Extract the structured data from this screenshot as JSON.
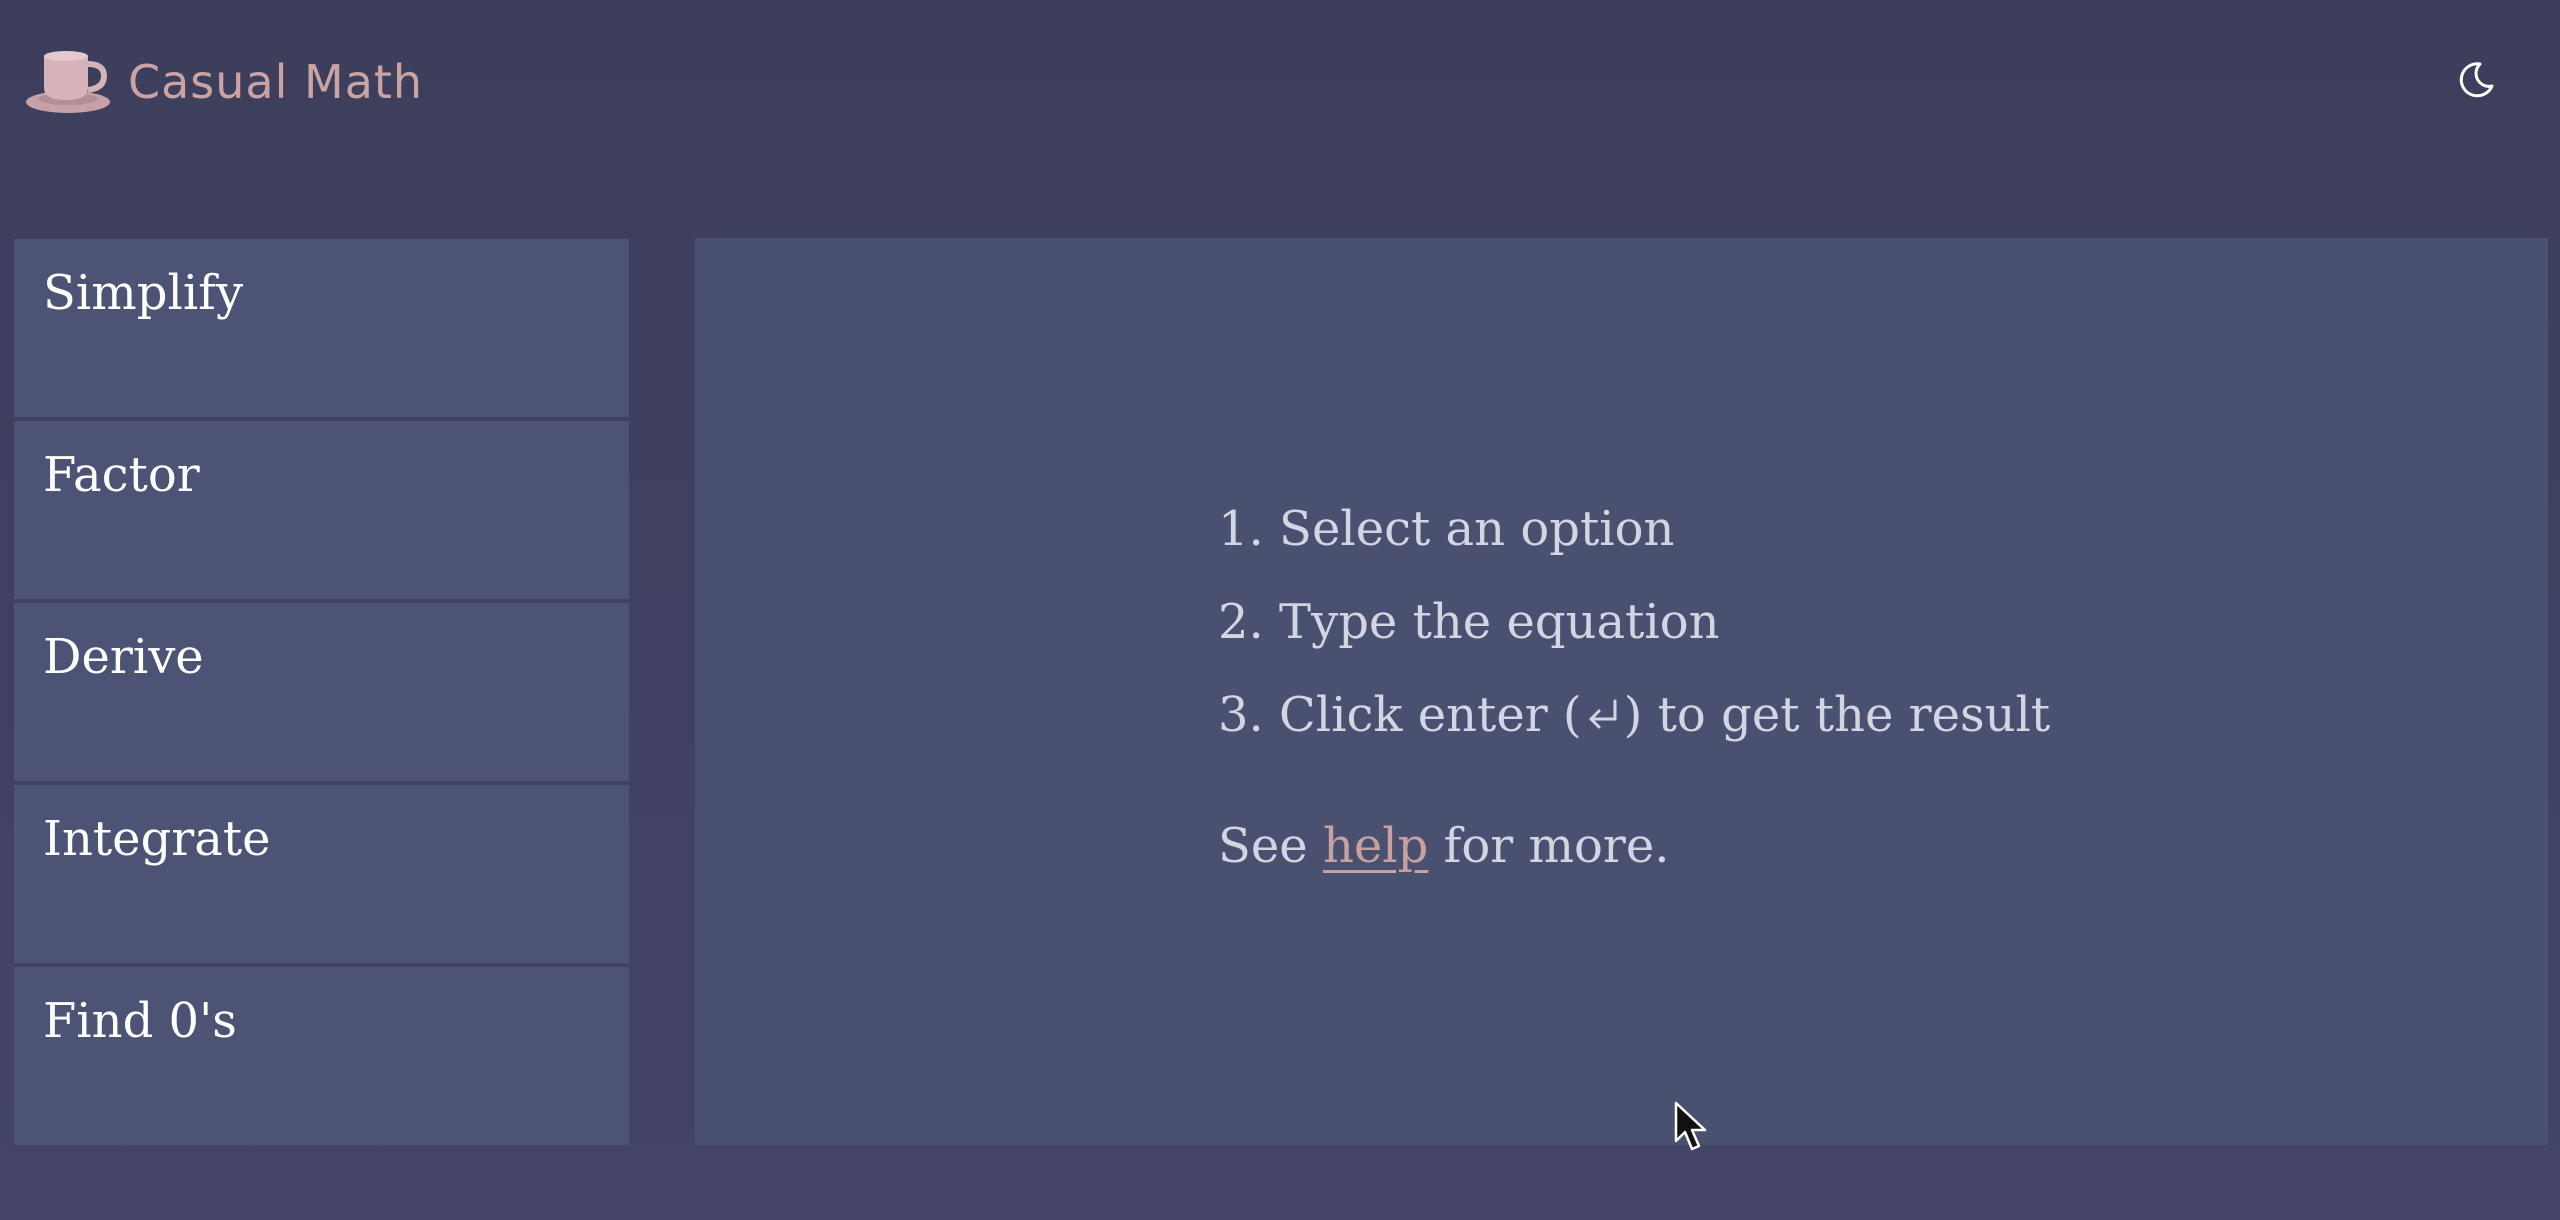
{
  "app": {
    "title": "Casual Math"
  },
  "header": {
    "logo_icon": "teacup-icon",
    "theme_toggle_icon": "moon-icon"
  },
  "sidebar": {
    "items": [
      {
        "label": "Simplify"
      },
      {
        "label": "Factor"
      },
      {
        "label": "Derive"
      },
      {
        "label": "Integrate"
      },
      {
        "label": "Find 0's"
      }
    ]
  },
  "main": {
    "steps": [
      {
        "text": "1. Select an option"
      },
      {
        "text": "2. Type the equation"
      },
      {
        "before": "3. Click enter (",
        "icon": "enter-return-icon",
        "after": ") to get the result"
      }
    ],
    "see_prefix": "See ",
    "help_link": "help",
    "see_suffix": " for more."
  },
  "colors": {
    "background": "#3d3d5c",
    "sidebar_item": "#4c5374",
    "panel": "#4a5070",
    "accent": "#caa3a3",
    "text": "#ffffff",
    "muted_text": "#d4d5e2"
  }
}
